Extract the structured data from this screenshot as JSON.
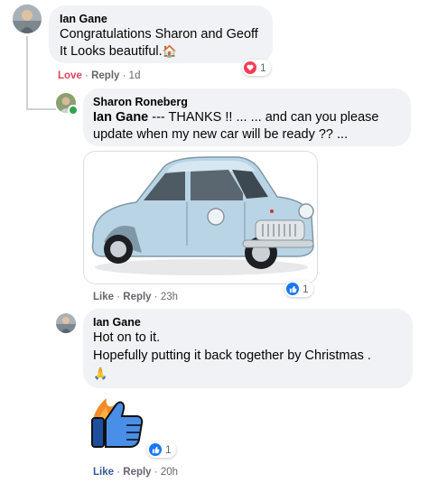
{
  "comments": [
    {
      "author": "Ian Gane",
      "lines": [
        "Congratulations Sharon and Geoff",
        "It Looks beautiful."
      ],
      "emoji": "🏠",
      "actions": {
        "reaction": "Love",
        "reply": "Reply",
        "sep": "·",
        "time": "1d"
      },
      "reaction_count": "1",
      "reaction_type": "heart-icon"
    },
    {
      "author": "Sharon Roneberg",
      "mention": "Ian Gane",
      "text_line1": " --- THANKS !! ... ... and can you please",
      "text_line2": "update when my new car will be ready ?? ...",
      "actions": {
        "reaction": "Like",
        "reply": "Reply",
        "sep": "·",
        "time": "23h"
      },
      "reaction_count": "1",
      "reaction_type": "thumbs-up-icon"
    },
    {
      "author": "Ian Gane",
      "lines": [
        "Hot on to it.",
        "Hopefully putting it back together by Christmas ."
      ],
      "emoji": "🙏",
      "actions": {
        "reaction": "Like",
        "reply": "Reply",
        "sep": "·",
        "time": "20h"
      },
      "reaction_count": "1",
      "reaction_type": "thumbs-up-icon"
    }
  ],
  "colors": {
    "bubble": "#f0f2f5",
    "love": "#e4405f",
    "like": "#1877f2",
    "meta": "#65676b",
    "online": "#31a24c"
  }
}
